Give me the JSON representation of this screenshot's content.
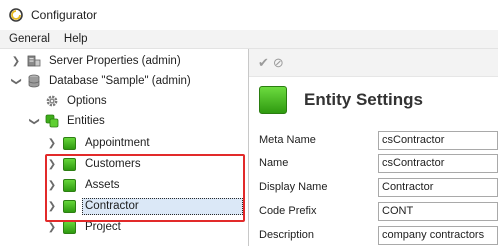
{
  "window": {
    "title": "Configurator"
  },
  "menu": {
    "general": "General",
    "help": "Help"
  },
  "tree": {
    "server_properties": "Server Properties (admin)",
    "database": "Database \"Sample\" (admin)",
    "options": "Options",
    "entities": "Entities",
    "appointment": "Appointment",
    "customers": "Customers",
    "assets": "Assets",
    "contractor": "Contractor",
    "project": "Project"
  },
  "details": {
    "title": "Entity Settings",
    "meta_name_label": "Meta Name",
    "meta_name_value": "csContractor",
    "name_label": "Name",
    "name_value": "csContractor",
    "display_name_label": "Display Name",
    "display_name_value": "Contractor",
    "code_prefix_label": "Code Prefix",
    "code_prefix_value": "CONT",
    "description_label": "Description",
    "description_value": "company contractors"
  },
  "colors": {
    "accent_green": "#3fae1a",
    "highlight_red": "#e22a2a",
    "selection": "#dbe8f7"
  },
  "icons": [
    "configurator-icon",
    "server-icon",
    "database-icon",
    "gear-icon",
    "entities-icon",
    "check-icon",
    "cancel-icon"
  ]
}
